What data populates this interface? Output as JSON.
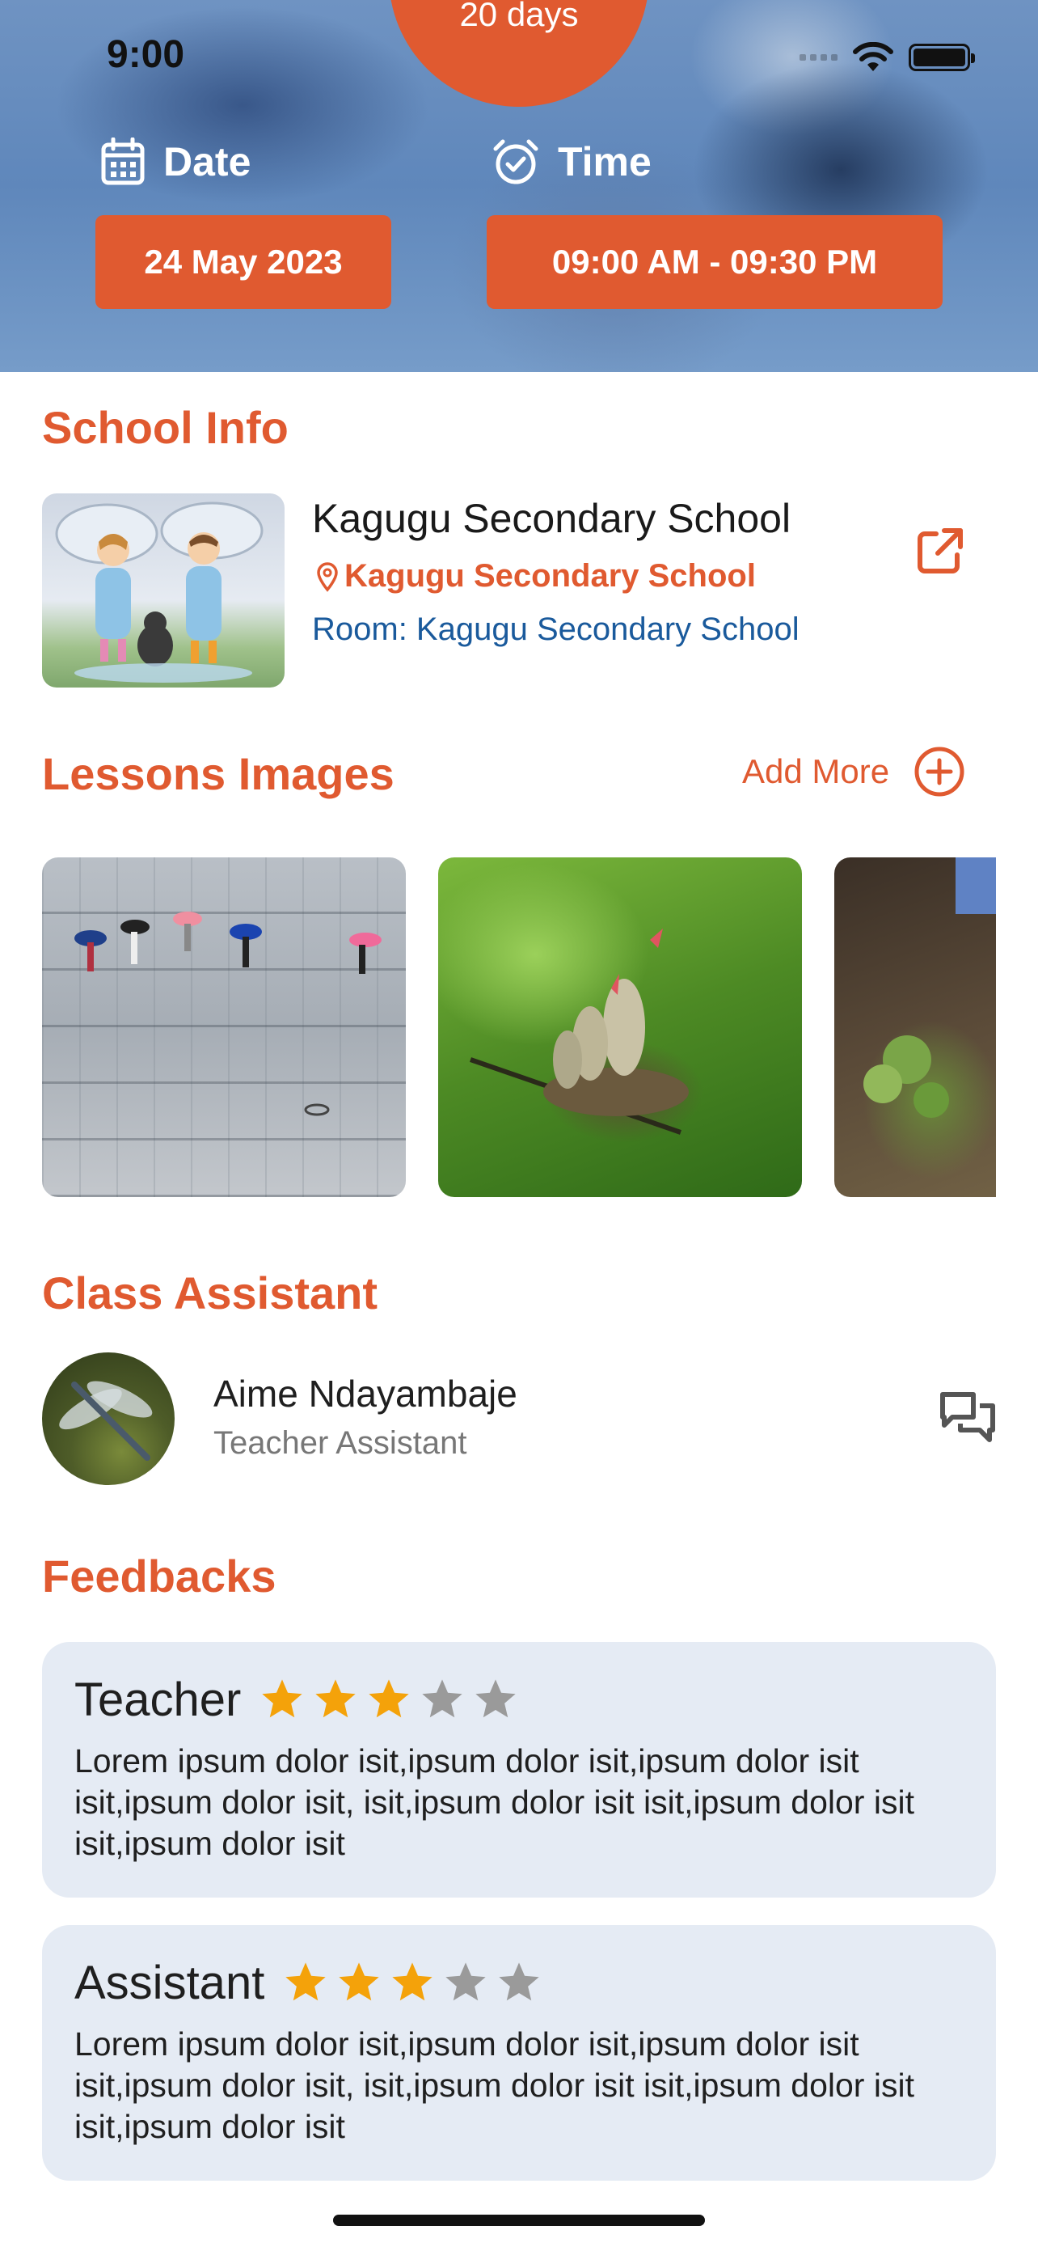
{
  "status_bar": {
    "time": "9:00"
  },
  "header": {
    "days_badge": "20 days",
    "date_label": "Date",
    "date_value": "24 May 2023",
    "time_label": "Time",
    "time_value": "09:00 AM - 09:30 PM"
  },
  "school_info": {
    "title": "School Info",
    "name": "Kagugu Secondary School",
    "location": "Kagugu Secondary School",
    "room": "Room: Kagugu Secondary School"
  },
  "lessons_images": {
    "title": "Lessons Images",
    "add_more_label": "Add More",
    "images": [
      "rainy-courtyard-umbrellas",
      "bird-nest-chicks",
      "rocky-cliff-plants"
    ]
  },
  "class_assistant": {
    "title": "Class Assistant",
    "name": "Aime Ndayambaje",
    "role": "Teacher Assistant"
  },
  "feedbacks": {
    "title": "Feedbacks",
    "items": [
      {
        "role": "Teacher",
        "rating": 3,
        "max_rating": 5,
        "text": "Lorem ipsum dolor isit,ipsum dolor isit,ipsum dolor isit isit,ipsum dolor isit, isit,ipsum dolor isit isit,ipsum dolor isit isit,ipsum dolor isit"
      },
      {
        "role": "Assistant",
        "rating": 3,
        "max_rating": 5,
        "text": "Lorem ipsum dolor isit,ipsum dolor isit,ipsum dolor isit isit,ipsum dolor isit, isit,ipsum dolor isit isit,ipsum dolor isit isit,ipsum dolor isit"
      }
    ]
  },
  "colors": {
    "accent": "#e05a30",
    "link_blue": "#1a5a9c",
    "star_filled": "#f4a20a",
    "star_empty": "#9a9a9a",
    "card_bg": "#e5ebf4"
  }
}
